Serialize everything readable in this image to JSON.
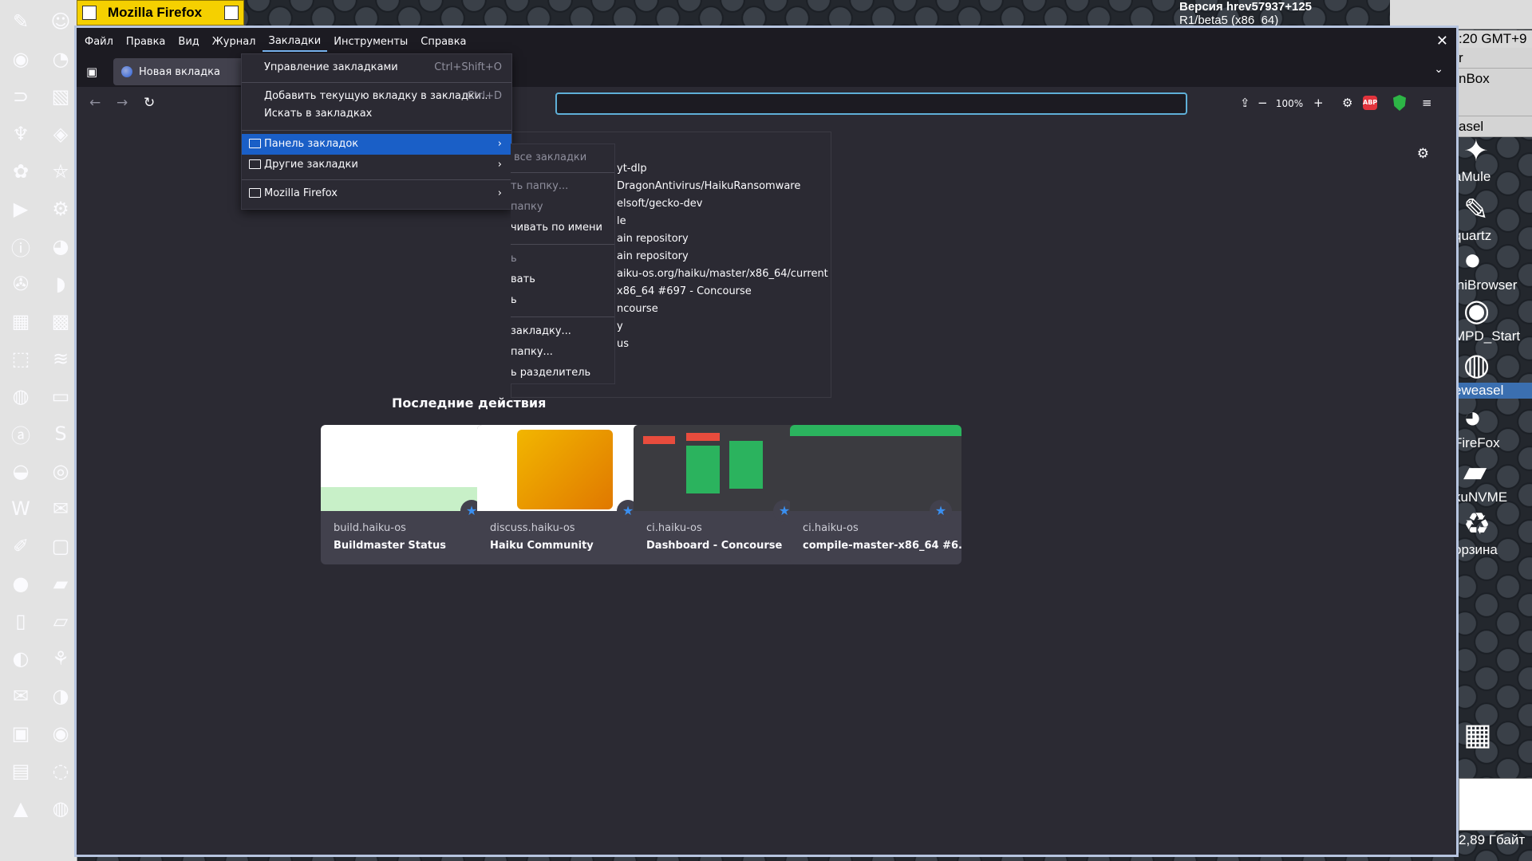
{
  "desktop": {
    "version_line1": "Версия hrev57937+125",
    "version_line2": "R1/beta5 (x86_64)",
    "clock": ":20 GMT+9",
    "deskbar_rows": [
      "r",
      "nBox",
      "asel"
    ],
    "icons": [
      "aMule",
      "quartz",
      "iniBrowser",
      "MPD_Start",
      "eweasel",
      "FireFox",
      "kuNVME",
      "орзина"
    ],
    "memory": "2,89 Гбайт"
  },
  "window": {
    "title": "Mozilla Firefox"
  },
  "menubar": [
    "Файл",
    "Правка",
    "Вид",
    "Журнал",
    "Закладки",
    "Инструменты",
    "Справка"
  ],
  "tab": {
    "label": "Новая вкладка"
  },
  "zoom": "100%",
  "abp": "ABP",
  "bookmarks_menu": {
    "manage": "Управление закладками",
    "manage_sc": "Ctrl+Shift+O",
    "add_current": "Добавить текущую вкладку в закладки...",
    "add_current_sc": "Ctrl+D",
    "search": "Искать в закладках",
    "toolbar": "Панель закладок",
    "other": "Другие закладки",
    "mozilla": "Mozilla Firefox"
  },
  "submenu": {
    "open_all": "все закладки",
    "new_folder": "ть папку...",
    "folder": "папку",
    "sort": "чивать по имени",
    "r1": "ь",
    "r2": "вать",
    "r3": "ь",
    "add_bm": "закладку...",
    "add_folder": "папку...",
    "add_sep": "ь разделитель"
  },
  "bm_items": [
    "yt-dlp",
    "DragonAntivirus/HaikuRansomware",
    "elsoft/gecko-dev",
    "le",
    "ain repository",
    "ain repository",
    "aiku-os.org/haiku/master/x86_64/current",
    "x86_64 #697 - Concourse",
    "ncourse",
    "y",
    "us"
  ],
  "recent": {
    "heading": "Последние действия",
    "cards": [
      {
        "host": "build.haiku-os",
        "title": "Buildmaster Status"
      },
      {
        "host": "discuss.haiku-os",
        "title": "Haiku Community"
      },
      {
        "host": "ci.haiku-os",
        "title": "Dashboard - Concourse"
      },
      {
        "host": "ci.haiku-os",
        "title": "compile-master-x86_64 #6..."
      }
    ]
  }
}
